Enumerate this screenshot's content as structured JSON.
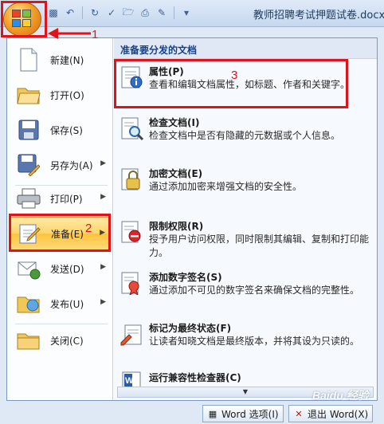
{
  "window": {
    "title": "教师招聘考试押题试卷.docx"
  },
  "quick_access": [
    "save-icon",
    "undo-icon",
    "redo-icon",
    "spellcheck-icon",
    "open-folder-icon",
    "print-icon",
    "edit-icon",
    "customize-icon"
  ],
  "left_menu": {
    "items": [
      {
        "label": "新建(N)",
        "icon": "new-document-icon",
        "has_submenu": false
      },
      {
        "label": "打开(O)",
        "icon": "open-folder-icon",
        "has_submenu": false
      },
      {
        "label": "保存(S)",
        "icon": "save-icon",
        "has_submenu": false
      },
      {
        "label": "另存为(A)",
        "icon": "save-as-icon",
        "has_submenu": true
      },
      {
        "label": "打印(P)",
        "icon": "print-icon",
        "has_submenu": true
      },
      {
        "label": "准备(E)",
        "icon": "prepare-icon",
        "has_submenu": true,
        "active": true
      },
      {
        "label": "发送(D)",
        "icon": "send-icon",
        "has_submenu": true
      },
      {
        "label": "发布(U)",
        "icon": "publish-icon",
        "has_submenu": true
      },
      {
        "label": "关闭(C)",
        "icon": "close-folder-icon",
        "has_submenu": false
      }
    ]
  },
  "submenu": {
    "header": "准备要分发的文档",
    "items": [
      {
        "title": "属性(P)",
        "desc": "查看和编辑文档属性，如标题、作者和关键字。",
        "icon": "properties-icon"
      },
      {
        "title": "检查文档(I)",
        "desc": "检查文档中是否有隐藏的元数据或个人信息。",
        "icon": "inspect-document-icon"
      },
      {
        "title": "加密文档(E)",
        "desc": "通过添加加密来增强文档的安全性。",
        "icon": "encrypt-lock-icon"
      },
      {
        "title": "限制权限(R)",
        "desc": "授予用户访问权限，同时限制其编辑、复制和打印能力。",
        "icon": "restrict-permission-icon"
      },
      {
        "title": "添加数字签名(S)",
        "desc": "通过添加不可见的数字签名来确保文档的完整性。",
        "icon": "digital-signature-icon"
      },
      {
        "title": "标记为最终状态(F)",
        "desc": "让读者知晓文档是最终版本，并将其设为只读的。",
        "icon": "mark-final-icon"
      },
      {
        "title": "运行兼容性检查器(C)",
        "desc": "",
        "icon": "compatibility-checker-icon"
      }
    ]
  },
  "bottom_buttons": {
    "options_label": "Word 选项(I)",
    "exit_label": "退出 Word(X)"
  },
  "annotations": {
    "n1": "1",
    "n2": "2",
    "n3": "3"
  },
  "watermark": "Baidu 经验",
  "colors": {
    "highlight": "#ffd46b",
    "annotation_red": "#e0121a",
    "header_blue": "#15428b"
  }
}
